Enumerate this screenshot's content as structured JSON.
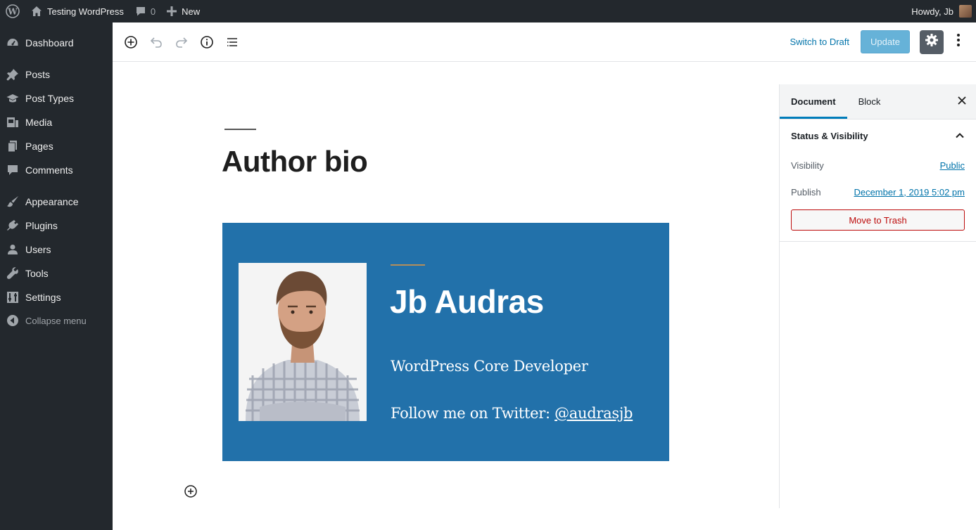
{
  "admin_bar": {
    "site_name": "Testing WordPress",
    "comments_count": "0",
    "new_label": "New",
    "greeting": "Howdy, Jb"
  },
  "sidebar": {
    "items": [
      {
        "label": "Dashboard",
        "icon": "dashboard-icon"
      },
      {
        "label": "Posts",
        "icon": "pin-icon"
      },
      {
        "label": "Post Types",
        "icon": "mortarboard-icon"
      },
      {
        "label": "Media",
        "icon": "media-icon"
      },
      {
        "label": "Pages",
        "icon": "pages-icon"
      },
      {
        "label": "Comments",
        "icon": "comment-icon"
      },
      {
        "label": "Appearance",
        "icon": "brush-icon"
      },
      {
        "label": "Plugins",
        "icon": "plugin-icon"
      },
      {
        "label": "Users",
        "icon": "user-icon"
      },
      {
        "label": "Tools",
        "icon": "wrench-icon"
      },
      {
        "label": "Settings",
        "icon": "sliders-icon"
      },
      {
        "label": "Collapse menu",
        "icon": "collapse-icon"
      }
    ]
  },
  "toolbar": {
    "switch_draft_label": "Switch to Draft",
    "update_label": "Update"
  },
  "post": {
    "title": "Author bio",
    "cover": {
      "name": "Jb Audras",
      "role": "WordPress Core Developer",
      "follow_prefix": "Follow me on Twitter: ",
      "follow_handle": "@audrasjb"
    }
  },
  "panel": {
    "tabs": [
      "Document",
      "Block"
    ],
    "section_title": "Status & Visibility",
    "visibility_label": "Visibility",
    "visibility_value": "Public",
    "publish_label": "Publish",
    "publish_value": "December 1, 2019 5:02 pm",
    "trash_label": "Move to Trash"
  },
  "colors": {
    "admin_dark": "#23282d",
    "cover_bg": "#2271aa",
    "accent": "#0073aa",
    "danger": "#bc0b0b"
  }
}
